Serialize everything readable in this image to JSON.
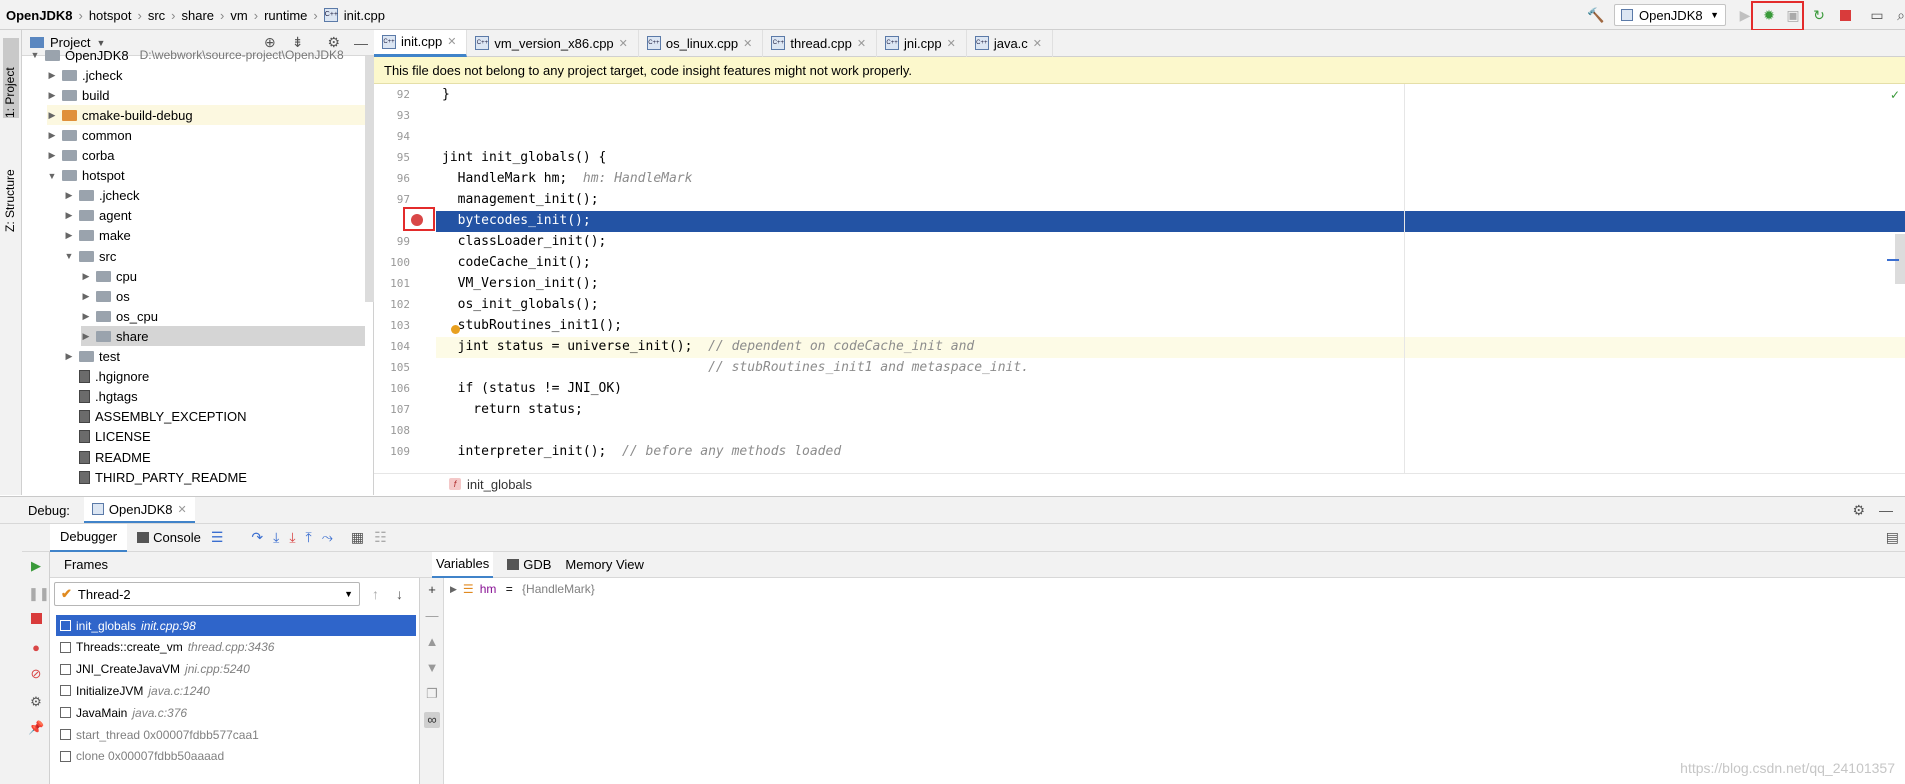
{
  "breadcrumb": [
    "OpenJDK8",
    "hotspot",
    "src",
    "share",
    "vm",
    "runtime",
    "init.cpp"
  ],
  "run_config": "OpenJDK8",
  "tool_strip": {
    "project_tab": "1: Project",
    "structure_tab": "Z: Structure"
  },
  "project_panel": {
    "title": "Project",
    "tree": [
      {
        "label": "OpenJDK8",
        "path": "D:\\webwork\\source-project\\OpenJDK8",
        "level": 0,
        "type": "folder",
        "expanded": true
      },
      {
        "label": ".jcheck",
        "level": 1,
        "type": "folder"
      },
      {
        "label": "build",
        "level": 1,
        "type": "folder"
      },
      {
        "label": "cmake-build-debug",
        "level": 1,
        "type": "folder-orange"
      },
      {
        "label": "common",
        "level": 1,
        "type": "folder"
      },
      {
        "label": "corba",
        "level": 1,
        "type": "folder"
      },
      {
        "label": "hotspot",
        "level": 1,
        "type": "folder",
        "expanded": true
      },
      {
        "label": ".jcheck",
        "level": 2,
        "type": "folder"
      },
      {
        "label": "agent",
        "level": 2,
        "type": "folder"
      },
      {
        "label": "make",
        "level": 2,
        "type": "folder"
      },
      {
        "label": "src",
        "level": 2,
        "type": "folder",
        "expanded": true
      },
      {
        "label": "cpu",
        "level": 3,
        "type": "folder"
      },
      {
        "label": "os",
        "level": 3,
        "type": "folder"
      },
      {
        "label": "os_cpu",
        "level": 3,
        "type": "folder"
      },
      {
        "label": "share",
        "level": 3,
        "type": "folder",
        "selected": true
      },
      {
        "label": "test",
        "level": 2,
        "type": "folder"
      },
      {
        "label": ".hgignore",
        "level": 2,
        "type": "file"
      },
      {
        "label": ".hgtags",
        "level": 2,
        "type": "file"
      },
      {
        "label": "ASSEMBLY_EXCEPTION",
        "level": 2,
        "type": "file"
      },
      {
        "label": "LICENSE",
        "level": 2,
        "type": "file"
      },
      {
        "label": "README",
        "level": 2,
        "type": "file"
      },
      {
        "label": "THIRD_PARTY_README",
        "level": 2,
        "type": "file"
      }
    ]
  },
  "editor_tabs": [
    {
      "label": "init.cpp",
      "active": true
    },
    {
      "label": "vm_version_x86.cpp"
    },
    {
      "label": "os_linux.cpp"
    },
    {
      "label": "thread.cpp"
    },
    {
      "label": "jni.cpp"
    },
    {
      "label": "java.c"
    }
  ],
  "banner": "This file does not belong to any project target, code insight features might not work properly.",
  "code_lines": [
    {
      "n": "92",
      "code": "}",
      "comment": ""
    },
    {
      "n": "93",
      "code": "",
      "comment": ""
    },
    {
      "n": "94",
      "code": "",
      "comment": ""
    },
    {
      "n": "95",
      "code": "jint init_globals() {",
      "comment": ""
    },
    {
      "n": "96",
      "code": "  HandleMark hm;  ",
      "comment": "hm: HandleMark"
    },
    {
      "n": "97",
      "code": "  management_init();",
      "comment": ""
    },
    {
      "n": "98",
      "code": "  bytecodes_init();",
      "comment": ""
    },
    {
      "n": "99",
      "code": "  classLoader_init();",
      "comment": ""
    },
    {
      "n": "100",
      "code": "  codeCache_init();",
      "comment": ""
    },
    {
      "n": "101",
      "code": "  VM_Version_init();",
      "comment": ""
    },
    {
      "n": "102",
      "code": "  os_init_globals();",
      "comment": ""
    },
    {
      "n": "103",
      "code": "  stubRoutines_init1();",
      "comment": ""
    },
    {
      "n": "104",
      "code": "  jint status = universe_init();  ",
      "comment": "// dependent on codeCache_init and"
    },
    {
      "n": "105",
      "code": "                                  ",
      "comment": "// stubRoutines_init1 and metaspace_init."
    },
    {
      "n": "106",
      "code": "  if (status != JNI_OK)",
      "comment": ""
    },
    {
      "n": "107",
      "code": "    return status;",
      "comment": ""
    },
    {
      "n": "108",
      "code": "",
      "comment": ""
    },
    {
      "n": "109",
      "code": "  interpreter_init();  ",
      "comment": "// before any methods loaded"
    }
  ],
  "status_function": "init_globals",
  "debug": {
    "label": "Debug:",
    "session": "OpenJDK8",
    "tabs": {
      "debugger": "Debugger",
      "console": "Console"
    },
    "frames_title": "Frames",
    "thread": "Thread-2",
    "frames": [
      {
        "fn": "init_globals",
        "loc": "init.cpp:98",
        "selected": true
      },
      {
        "fn": "Threads::create_vm",
        "loc": "thread.cpp:3436"
      },
      {
        "fn": "JNI_CreateJavaVM",
        "loc": "jni.cpp:5240"
      },
      {
        "fn": "InitializeJVM",
        "loc": "java.c:1240"
      },
      {
        "fn": "JavaMain",
        "loc": "java.c:376"
      },
      {
        "fn": "start_thread 0x00007fdbb577caa1",
        "loc": "",
        "dim": true
      },
      {
        "fn": "clone 0x00007fdbb50aaaad",
        "loc": "",
        "dim": true
      }
    ],
    "var_tabs": {
      "variables": "Variables",
      "gdb": "GDB",
      "memory": "Memory View"
    },
    "variables": [
      {
        "name": "hm",
        "eq": " = ",
        "value": "{HandleMark}"
      }
    ]
  },
  "watermark": "https://blog.csdn.net/qq_24101357"
}
